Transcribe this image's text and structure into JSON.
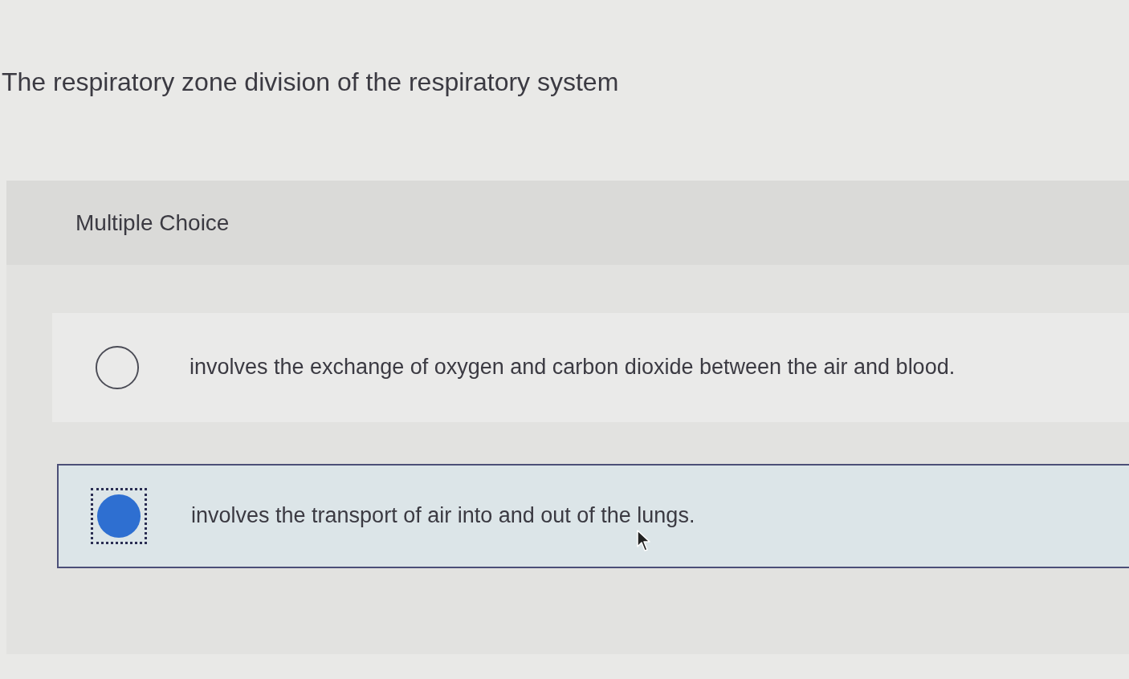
{
  "question": {
    "text": "The respiratory zone division of the respiratory system"
  },
  "section": {
    "label": "Multiple Choice"
  },
  "options": [
    {
      "text": "involves the exchange of oxygen and carbon dioxide between the air and blood.",
      "selected": false
    },
    {
      "text": "involves the transport of air into and out of the lungs.",
      "selected": true
    }
  ]
}
